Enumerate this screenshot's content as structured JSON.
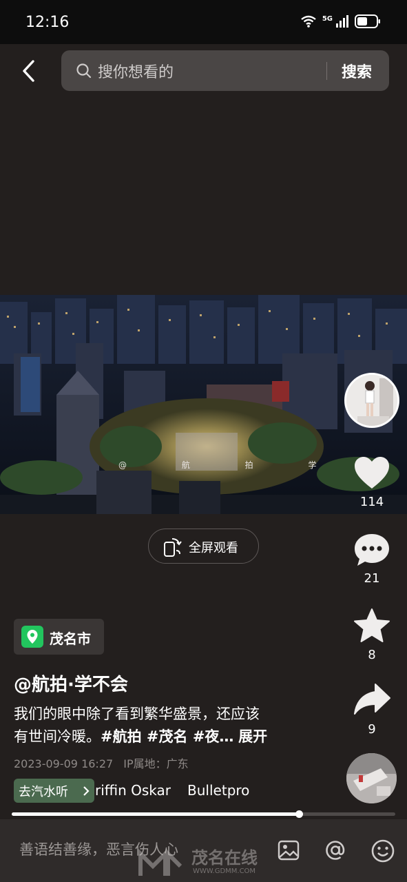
{
  "status_bar": {
    "time": "12:16",
    "network": "5G"
  },
  "search": {
    "placeholder": "搜你想看的",
    "button_label": "搜索"
  },
  "video": {
    "overlay_caption": "@ 航 拍 学 不 会"
  },
  "fullscreen": {
    "label": "全屏观看"
  },
  "actions": {
    "likes": "114",
    "comments": "21",
    "favorites": "8",
    "shares": "9"
  },
  "post": {
    "location": "茂名市",
    "author": "@航拍·学不会",
    "desc_line1": "我们的眼中除了看到繁华盛景，还应该",
    "desc_line2_text": "有世间冷暖。",
    "tags": "#航拍 #茂名 #夜…",
    "expand": "展开",
    "date": "2023-09-09 16:27",
    "ip": "IP属地：广东"
  },
  "music": {
    "chip_label": "去汽水听",
    "track_a": "riffin Oskar",
    "track_b": "Bulletpro"
  },
  "playback": {
    "progress_fraction": 0.75
  },
  "comment_bar": {
    "placeholder": "善语结善缘，恶言伤人心"
  },
  "watermark": {
    "text": "茂名在线",
    "url": "WWW.GDMM.COM"
  },
  "icons": [
    "back-icon",
    "search-icon",
    "wifi-icon",
    "signal-icon",
    "battery-icon",
    "phone-rotate-icon",
    "heart-icon",
    "comment-icon",
    "star-icon",
    "share-icon",
    "location-pin-icon",
    "chevron-right-icon",
    "image-icon",
    "at-icon",
    "emoji-icon"
  ],
  "colors": {
    "background": "#231f1e",
    "location_pin": "#22c55e",
    "music_chip": "#4b6a4f"
  }
}
